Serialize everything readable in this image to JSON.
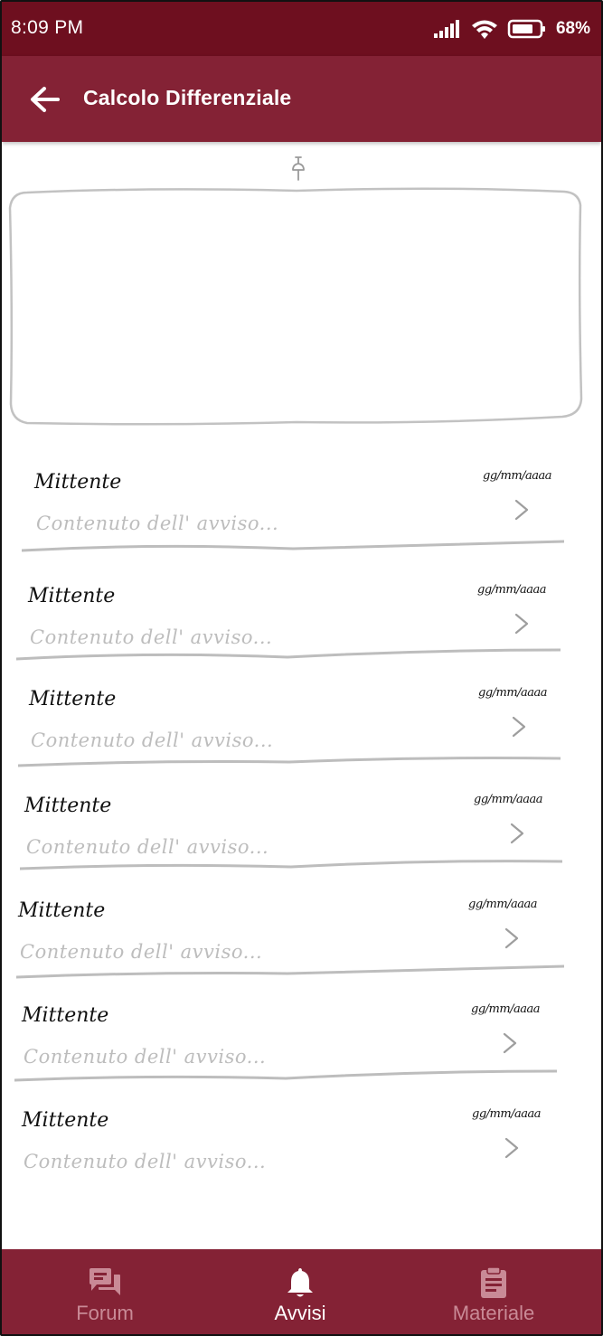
{
  "status_bar": {
    "time": "8:09 PM",
    "battery_percent": "68%",
    "icons": [
      "signal-icon",
      "wifi-icon",
      "battery-icon"
    ]
  },
  "app_bar": {
    "title": "Calcolo Differenziale",
    "back_icon": "arrow-back-icon"
  },
  "colors": {
    "status_bar": "#6e0f1f",
    "app_bar": "#842235",
    "nav_inactive": "#c98a96",
    "nav_active": "#ffffff",
    "preview_text": "#bdbdbd"
  },
  "notices": [
    {
      "sender": "Mittente",
      "date": "gg/mm/aaaa",
      "preview": "Contenuto dell' avviso..."
    },
    {
      "sender": "Mittente",
      "date": "gg/mm/aaaa",
      "preview": "Contenuto dell' avviso..."
    },
    {
      "sender": "Mittente",
      "date": "gg/mm/aaaa",
      "preview": "Contenuto dell' avviso..."
    },
    {
      "sender": "Mittente",
      "date": "gg/mm/aaaa",
      "preview": "Contenuto dell' avviso..."
    },
    {
      "sender": "Mittente",
      "date": "gg/mm/aaaa",
      "preview": "Contenuto dell' avviso..."
    },
    {
      "sender": "Mittente",
      "date": "gg/mm/aaaa",
      "preview": "Contenuto dell' avviso..."
    },
    {
      "sender": "Mittente",
      "date": "gg/mm/aaaa",
      "preview": "Contenuto dell' avviso..."
    }
  ],
  "bottom_nav": {
    "items": [
      {
        "label": "Forum",
        "icon": "forum-icon",
        "active": false
      },
      {
        "label": "Avvisi",
        "icon": "bell-icon",
        "active": true
      },
      {
        "label": "Materiale",
        "icon": "clipboard-icon",
        "active": false
      }
    ]
  }
}
